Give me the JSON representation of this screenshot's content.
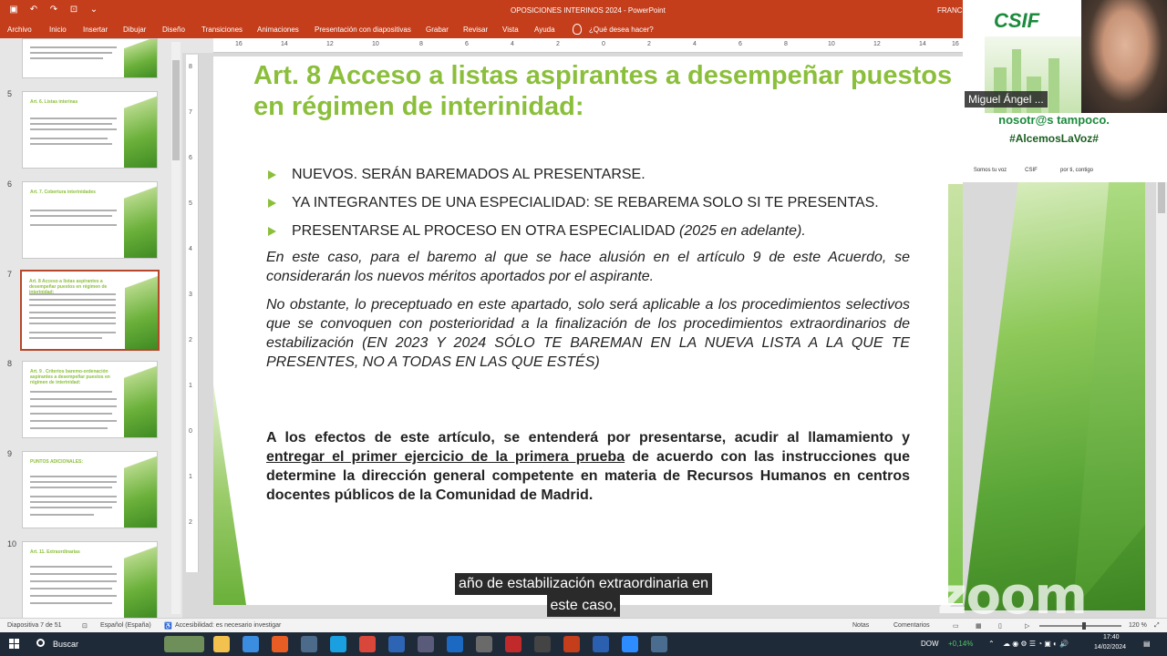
{
  "window": {
    "title": "OPOSICIONES INTERINOS 2024  -  PowerPoint",
    "user": "FRANC"
  },
  "ribbon": {
    "tabs": [
      "Archivo",
      "Inicio",
      "Insertar",
      "Dibujar",
      "Diseño",
      "Transiciones",
      "Animaciones",
      "Presentación con diapositivas",
      "Grabar",
      "Revisar",
      "Vista",
      "Ayuda"
    ],
    "tellme": "¿Qué desea hacer?"
  },
  "thumbnails": [
    {
      "num": "5",
      "title": "Art. 6. Listas interinas",
      "active": false
    },
    {
      "num": "6",
      "title": "Art. 7. Cobertura interinidades",
      "active": false
    },
    {
      "num": "7",
      "title": "Art. 8 Acceso a listas aspirantes a desempeñar puestos en régimen de interinidad:",
      "active": true
    },
    {
      "num": "8",
      "title": "Art. 9 . Criterios baremo-ordenación aspirantes a desempeñar puestos en régimen de interinidad:",
      "active": false
    },
    {
      "num": "9",
      "title": "PUNTOS ADICIONALES:",
      "active": false
    },
    {
      "num": "10",
      "title": "Art. 11. Extraordinarias",
      "active": false
    }
  ],
  "slide": {
    "title": "Art. 8 Acceso a listas aspirantes a desempeñar puestos en régimen de interinidad:",
    "bullets": [
      "NUEVOS. SERÁN BAREMADOS AL PRESENTARSE.",
      "YA INTEGRANTES DE UNA ESPECIALIDAD: SE REBAREMA SOLO SI TE PRESENTAS."
    ],
    "bullet3_main": "PRESENTARSE AL PROCESO EN OTRA ESPECIALIDAD ",
    "bullet3_italic": "(2025 en adelante).",
    "para1": "En este caso, para el baremo al que se hace alusión en el artículo 9 de este Acuerdo, se considerarán los nuevos méritos aportados por el aspirante.",
    "para2_italic": "No obstante, lo preceptuado en este apartado, solo será aplicable a los procedimientos selectivos que se convoquen con posterioridad a la finalización de los procedimientos extraordinarios de estabilización",
    "para2_upper": " (EN 2023 Y 2024 SÓLO TE BAREMAN EN LA NUEVA LISTA A LA QUE TE PRESENTES, NO A TODAS EN LAS QUE ESTÉS)",
    "para3_a": "A los efectos de este artículo, se entenderá por presentarse, acudir al llamamiento y ",
    "para3_u": "entregar el primer ejercicio de la primera prueba",
    "para3_b": " de acuerdo con las instrucciones que determine la dirección general competente en materia de Recursos Humanos en centros docentes públicos de la Comunidad de Madrid."
  },
  "video": {
    "logo": "CSIF",
    "participant": "Miguel Ángel ...",
    "slogan1": "nosotr@s tampoco.",
    "slogan2": "#AlcemosLaVoz#",
    "label1": "Somos tu voz",
    "label2": "CSIF",
    "label3": "por ti, contigo"
  },
  "caption": {
    "line1": "año de estabilización extraordinaria en",
    "line2": "este caso,"
  },
  "zoom_logo": "zoom",
  "statusbar": {
    "slide_count": "Diapositiva 7 de 51",
    "language": "Español (España)",
    "accessibility": "Accesibilidad: es necesario investigar",
    "notes": "Notas",
    "comments": "Comentarios",
    "zoom": "120 %",
    "zoom_level": 0.55
  },
  "taskbar": {
    "search": "Buscar",
    "stock": "DOW",
    "stock_change": "+0,14%",
    "time": "17:40",
    "date": "14/02/2024"
  },
  "colors": {
    "accent": "#c43e1c",
    "title_green": "#8bbf3b"
  }
}
